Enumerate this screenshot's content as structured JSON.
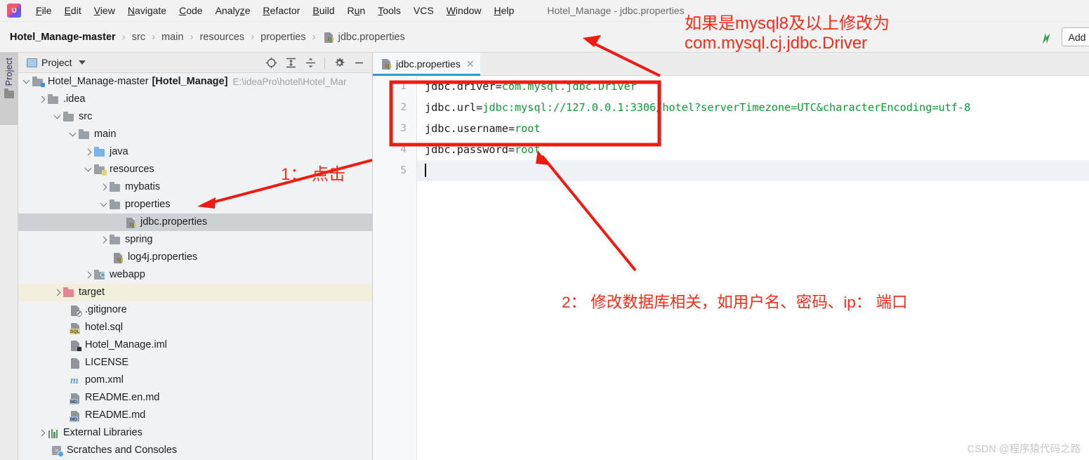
{
  "window": {
    "title": "Hotel_Manage - jdbc.properties",
    "logo_icon": "intellij-idea-logo"
  },
  "menubar": {
    "items": [
      {
        "label": "File",
        "mnemonic": "F"
      },
      {
        "label": "Edit",
        "mnemonic": "E"
      },
      {
        "label": "View",
        "mnemonic": "V"
      },
      {
        "label": "Navigate",
        "mnemonic": "N"
      },
      {
        "label": "Code",
        "mnemonic": "C"
      },
      {
        "label": "Analyze",
        "mnemonic": "z"
      },
      {
        "label": "Refactor",
        "mnemonic": "R"
      },
      {
        "label": "Build",
        "mnemonic": "B"
      },
      {
        "label": "Run",
        "mnemonic": "u"
      },
      {
        "label": "Tools",
        "mnemonic": "T"
      },
      {
        "label": "VCS",
        "mnemonic": ""
      },
      {
        "label": "Window",
        "mnemonic": "W"
      },
      {
        "label": "Help",
        "mnemonic": "H"
      }
    ]
  },
  "navbar": {
    "breadcrumbs": [
      {
        "label": "Hotel_Manage-master",
        "icon": ""
      },
      {
        "label": "src",
        "icon": ""
      },
      {
        "label": "main",
        "icon": ""
      },
      {
        "label": "resources",
        "icon": ""
      },
      {
        "label": "properties",
        "icon": ""
      },
      {
        "label": "jdbc.properties",
        "icon": "properties-file-icon"
      }
    ],
    "separator": "›",
    "run_icon": "run-arrow-icon",
    "add_config_label": "Add Confi"
  },
  "toolstrip": {
    "label": "Project",
    "icon": "folder-icon"
  },
  "project_panel": {
    "title": "Project",
    "window_icon": "project-window-icon",
    "caret_icon": "chevron-down-icon",
    "tools": [
      {
        "name": "locate-icon",
        "glyph": "target"
      },
      {
        "name": "expand-all-icon",
        "glyph": "expand"
      },
      {
        "name": "collapse-all-icon",
        "glyph": "collapse"
      },
      {
        "name": "settings-gear-icon",
        "glyph": "gear"
      },
      {
        "name": "hide-panel-icon",
        "glyph": "minus"
      }
    ],
    "tree": [
      {
        "label": "Hotel_Manage-master",
        "bold_suffix": "[Hotel_Manage]",
        "path": "E:\\ideaPro\\hotel\\Hotel_Mar",
        "indent": 0,
        "arrow": "down",
        "icon": "module-folder-icon",
        "selected": false,
        "highlight": false
      },
      {
        "label": ".idea",
        "indent": 1,
        "arrow": "right",
        "icon": "folder-icon",
        "selected": false,
        "highlight": false
      },
      {
        "label": "src",
        "indent": 1,
        "arrow": "down",
        "icon": "folder-icon",
        "selected": false,
        "highlight": false
      },
      {
        "label": "main",
        "indent": 2,
        "arrow": "down",
        "icon": "folder-icon",
        "selected": false,
        "highlight": false
      },
      {
        "label": "java",
        "indent": 3,
        "arrow": "right",
        "icon": "source-folder-icon",
        "selected": false,
        "highlight": false
      },
      {
        "label": "resources",
        "indent": 3,
        "arrow": "down",
        "icon": "resources-folder-icon",
        "selected": false,
        "highlight": false
      },
      {
        "label": "mybatis",
        "indent": 4,
        "arrow": "right",
        "icon": "folder-icon",
        "selected": false,
        "highlight": false
      },
      {
        "label": "properties",
        "indent": 4,
        "arrow": "down",
        "icon": "folder-icon",
        "selected": false,
        "highlight": false
      },
      {
        "label": "jdbc.properties",
        "indent": 5,
        "arrow": "none",
        "icon": "properties-file-icon",
        "selected": true,
        "highlight": false
      },
      {
        "label": "spring",
        "indent": 4,
        "arrow": "right",
        "icon": "folder-icon",
        "selected": false,
        "highlight": false
      },
      {
        "label": "log4j.properties",
        "indent": 4,
        "arrow": "none",
        "icon": "properties-file-icon",
        "selected": false,
        "highlight": false
      },
      {
        "label": "webapp",
        "indent": 3,
        "arrow": "right",
        "icon": "web-folder-icon",
        "selected": false,
        "highlight": false
      },
      {
        "label": "target",
        "indent": 2,
        "arrow": "right",
        "icon": "excluded-folder-icon",
        "selected": false,
        "highlight": true
      },
      {
        "label": ".gitignore",
        "indent": 2,
        "arrow": "none",
        "icon": "gitignore-file-icon",
        "selected": false,
        "highlight": false
      },
      {
        "label": "hotel.sql",
        "indent": 2,
        "arrow": "none",
        "icon": "sql-file-icon",
        "selected": false,
        "highlight": false
      },
      {
        "label": "Hotel_Manage.iml",
        "indent": 2,
        "arrow": "none",
        "icon": "iml-file-icon",
        "selected": false,
        "highlight": false
      },
      {
        "label": "LICENSE",
        "indent": 2,
        "arrow": "none",
        "icon": "text-file-icon",
        "selected": false,
        "highlight": false
      },
      {
        "label": "pom.xml",
        "indent": 2,
        "arrow": "none",
        "icon": "maven-file-icon",
        "selected": false,
        "highlight": false
      },
      {
        "label": "README.en.md",
        "indent": 2,
        "arrow": "none",
        "icon": "markdown-file-icon",
        "selected": false,
        "highlight": false
      },
      {
        "label": "README.md",
        "indent": 2,
        "arrow": "none",
        "icon": "markdown-file-icon",
        "selected": false,
        "highlight": false
      },
      {
        "label": "External Libraries",
        "indent": 1,
        "arrow": "right",
        "icon": "external-libraries-icon",
        "selected": false,
        "highlight": false
      },
      {
        "label": "Scratches and Consoles",
        "indent": 1,
        "arrow": "none",
        "icon": "scratches-icon",
        "selected": false,
        "highlight": false
      }
    ]
  },
  "editor": {
    "tab": {
      "label": "jdbc.properties",
      "icon": "properties-file-icon",
      "close_icon": "close-icon"
    },
    "line_numbers": [
      "1",
      "2",
      "3",
      "4",
      "5"
    ],
    "lines": [
      {
        "key": "jdbc.driver=",
        "value": "com.mysql.jdbc.Driver"
      },
      {
        "key": "jdbc.url=",
        "value": "jdbc:mysql://127.0.0.1:3306/hotel?serverTimezone=UTC&characterEncoding=utf-8"
      },
      {
        "key": "jdbc.username=",
        "value": "root"
      },
      {
        "key": "jdbc.password=",
        "value": "root"
      },
      {
        "key": "",
        "value": ""
      }
    ]
  },
  "annotations": {
    "driver_note_line1": "如果是mysql8及以上修改为",
    "driver_note_line2": "com.mysql.cj.jdbc.Driver",
    "step1": "1： 点击",
    "step2": "2： 修改数据库相关，如用户名、密码、ip： 端口",
    "color": "#fc2a18"
  },
  "watermark": "CSDN @程序猿代码之路"
}
